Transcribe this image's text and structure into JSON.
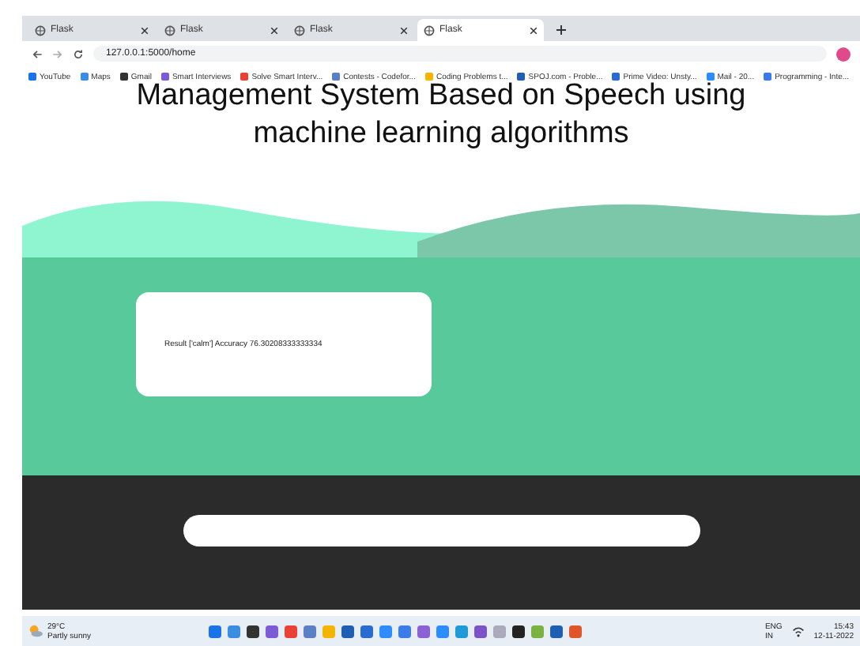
{
  "browser": {
    "tabs": [
      {
        "label": "Flask",
        "selected": false
      },
      {
        "label": "Flask",
        "selected": false
      },
      {
        "label": "Flask",
        "selected": false
      },
      {
        "label": "Flask",
        "selected": true
      }
    ],
    "url": "127.0.0.1:5000/home",
    "bookmarks": [
      "YouTube",
      "Maps",
      "Gmail",
      "Smart Interviews",
      "Solve Smart Interv...",
      "Contests - Codefor...",
      "Coding Problems t...",
      "SPOJ.com - Proble...",
      "Prime Video: Unsty...",
      "Mail - 20...",
      "Programming - Inte..."
    ]
  },
  "page": {
    "heading": [
      "Management System Based on Speech using",
      "machine learning algorithms"
    ],
    "result": "Result ['calm'] Accuracy 76.30208333333334"
  },
  "taskbar": {
    "weather": {
      "temp": "29°C",
      "condition": "Partly sunny"
    },
    "tray_lang": [
      "ENG",
      "IN"
    ],
    "time": "15:43",
    "date": "12-11-2022"
  }
}
